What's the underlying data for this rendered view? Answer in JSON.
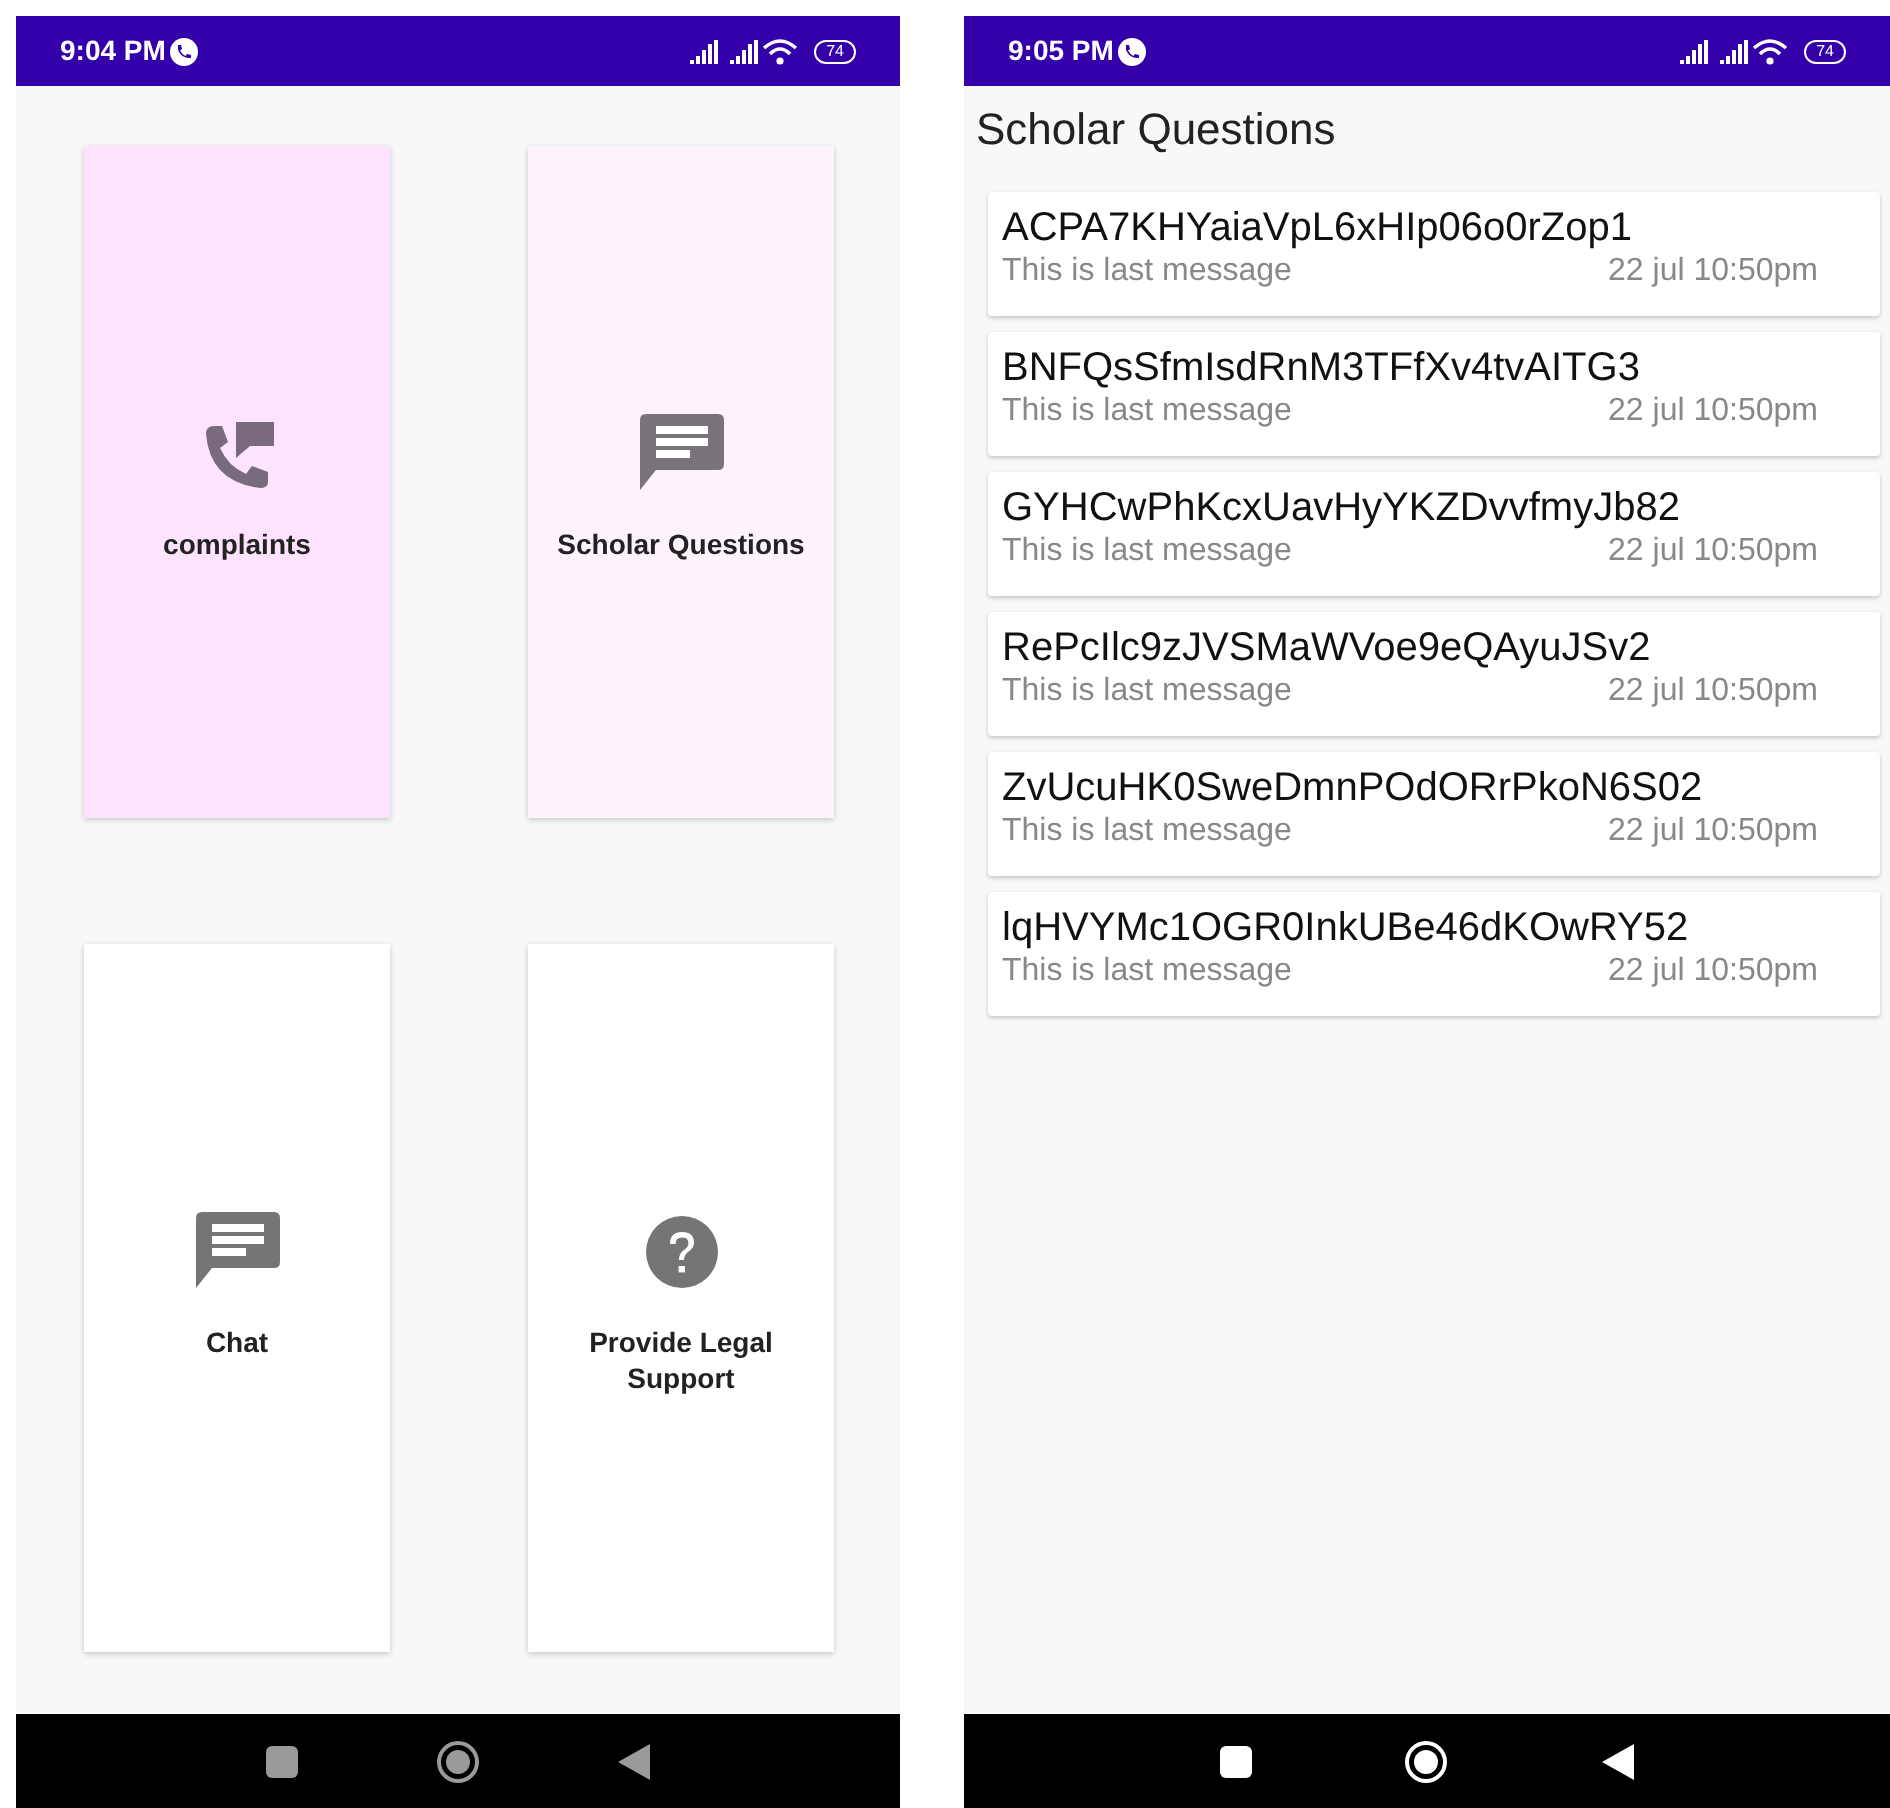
{
  "screens": [
    {
      "status_bar": {
        "time": "9:04 PM",
        "battery": "74"
      },
      "tiles": [
        {
          "label": "complaints",
          "color": "#fde3fd"
        },
        {
          "label": "Scholar Questions",
          "color": "#fdf3fd"
        },
        {
          "label": "Chat",
          "color": "#ffffff"
        },
        {
          "label": "Provide Legal Support",
          "color": "#ffffff"
        }
      ],
      "nav_dimmed": true
    },
    {
      "status_bar": {
        "time": "9:05 PM",
        "battery": "74"
      },
      "title": "Scholar Questions",
      "messages": [
        {
          "name": "ACPA7KHYaiaVpL6xHIp06o0rZop1",
          "preview": "This is last message",
          "time": "22 jul 10:50pm"
        },
        {
          "name": "BNFQsSfmIsdRnM3TFfXv4tvAITG3",
          "preview": "This is last message",
          "time": "22 jul 10:50pm"
        },
        {
          "name": "GYHCwPhKcxUavHyYKZDvvfmyJb82",
          "preview": "This is last message",
          "time": "22 jul 10:50pm"
        },
        {
          "name": "RePcIlc9zJVSMaWVoe9eQAyuJSv2",
          "preview": "This is last message",
          "time": "22 jul 10:50pm"
        },
        {
          "name": "ZvUcuHK0SweDmnPOdORrPkoN6S02",
          "preview": "This is last message",
          "time": "22 jul 10:50pm"
        },
        {
          "name": "lqHVYMc1OGR0InkUBe46dKOwRY52",
          "preview": "This is last message",
          "time": "22 jul 10:50pm"
        }
      ],
      "nav_dimmed": false
    }
  ]
}
